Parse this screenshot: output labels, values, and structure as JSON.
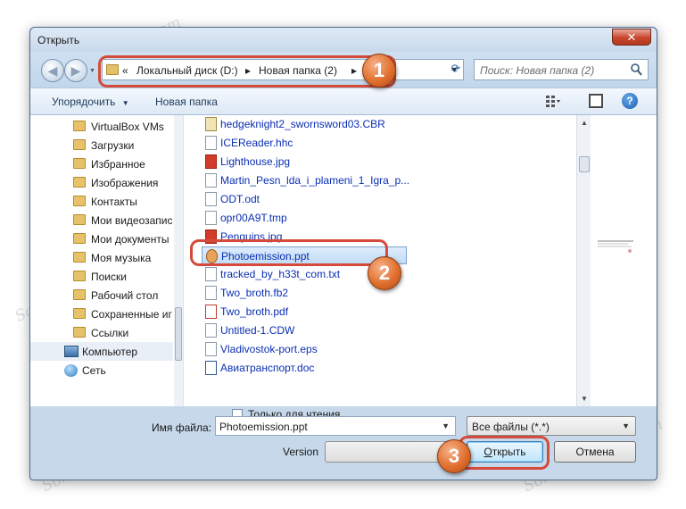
{
  "window": {
    "title": "Открыть",
    "close_glyph": "✕"
  },
  "address_bar": {
    "overflow": "«",
    "crumbs": [
      "Локальный диск (D:)",
      "Новая папка (2)"
    ],
    "separator": "▸",
    "dropdown_glyph": "▼",
    "refresh_glyph": "⟳"
  },
  "search": {
    "placeholder": "Поиск: Новая папка (2)"
  },
  "toolbar": {
    "organize_label": "Упорядочить",
    "organize_arrow": "▼",
    "new_folder_label": "Новая папка",
    "help_glyph": "?"
  },
  "nav_pane": {
    "items": [
      {
        "label": "VirtualBox VMs",
        "icon": "folder-icon"
      },
      {
        "label": "Загрузки",
        "icon": "folder-icon"
      },
      {
        "label": "Избранное",
        "icon": "folder-icon"
      },
      {
        "label": "Изображения",
        "icon": "folder-icon"
      },
      {
        "label": "Контакты",
        "icon": "folder-icon"
      },
      {
        "label": "Мои видеозапис",
        "icon": "folder-icon"
      },
      {
        "label": "Мои документы",
        "icon": "folder-icon"
      },
      {
        "label": "Моя музыка",
        "icon": "folder-icon"
      },
      {
        "label": "Поиски",
        "icon": "folder-icon"
      },
      {
        "label": "Рабочий стол",
        "icon": "folder-icon"
      },
      {
        "label": "Сохраненные иг",
        "icon": "folder-icon"
      },
      {
        "label": "Ссылки",
        "icon": "folder-icon"
      },
      {
        "label": "Компьютер",
        "icon": "computer-icon"
      },
      {
        "label": "Сеть",
        "icon": "network-icon"
      }
    ]
  },
  "files": [
    {
      "name": "hedgeknight2_swornsword03.CBR",
      "type": "cbr"
    },
    {
      "name": "ICEReader.hhc",
      "type": "generic"
    },
    {
      "name": "Lighthouse.jpg",
      "type": "jpg"
    },
    {
      "name": "Martin_Pesn_lda_i_plameni_1_Igra_p...",
      "type": "generic"
    },
    {
      "name": "ODT.odt",
      "type": "generic"
    },
    {
      "name": "opr00A9T.tmp",
      "type": "generic"
    },
    {
      "name": "Penguins.jpg",
      "type": "jpg"
    },
    {
      "name": "Photoemission.ppt",
      "type": "ppt",
      "selected": true
    },
    {
      "name": "tracked_by_h33t_com.txt",
      "type": "generic"
    },
    {
      "name": "Two_broth.fb2",
      "type": "generic"
    },
    {
      "name": "Two_broth.pdf",
      "type": "pdf"
    },
    {
      "name": "Untitled-1.CDW",
      "type": "generic"
    },
    {
      "name": "Vladivostok-port.eps",
      "type": "generic"
    },
    {
      "name": "Авиатранспорт.doc",
      "type": "doc"
    }
  ],
  "read_only": {
    "label": "Только для чтения",
    "checked": false
  },
  "filename": {
    "label": "Имя файла:",
    "value": "Photoemission.ppt"
  },
  "filetype": {
    "value": "Все файлы (*.*)"
  },
  "version": {
    "label": "Version"
  },
  "buttons": {
    "open_accel": "О",
    "open_rest": "ткрыть",
    "cancel": "Отмена"
  },
  "callouts": [
    "1",
    "2",
    "3"
  ],
  "watermark": "Sovetclub.ru"
}
